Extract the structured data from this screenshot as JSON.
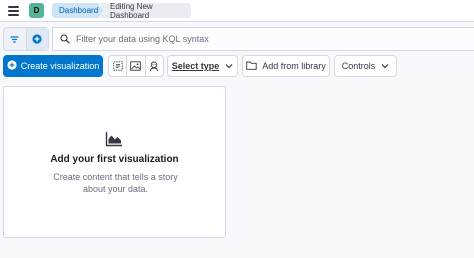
{
  "header": {
    "avatar_letter": "D",
    "breadcrumbs": [
      "Dashboard",
      "Editing New Dashboard"
    ]
  },
  "query": {
    "placeholder": "Filter your data using KQL syntax"
  },
  "toolbar": {
    "create_label": "Create visualization",
    "select_type_label": "Select type",
    "add_library_label": "Add from library",
    "controls_label": "Controls"
  },
  "empty_panel": {
    "title": "Add your first visualization",
    "description": "Create content that tells a story about your data."
  },
  "colors": {
    "primary": "#0077cc",
    "avatar": "#54b399",
    "breadcrumb_active": "#cce4f5"
  },
  "icons": [
    "menu-icon",
    "filter-icon",
    "add-filter-icon",
    "search-icon",
    "plus-in-circle-icon",
    "text-icon",
    "image-icon",
    "face-icon",
    "chevron-down-icon",
    "folder-icon",
    "chart-area-icon"
  ]
}
